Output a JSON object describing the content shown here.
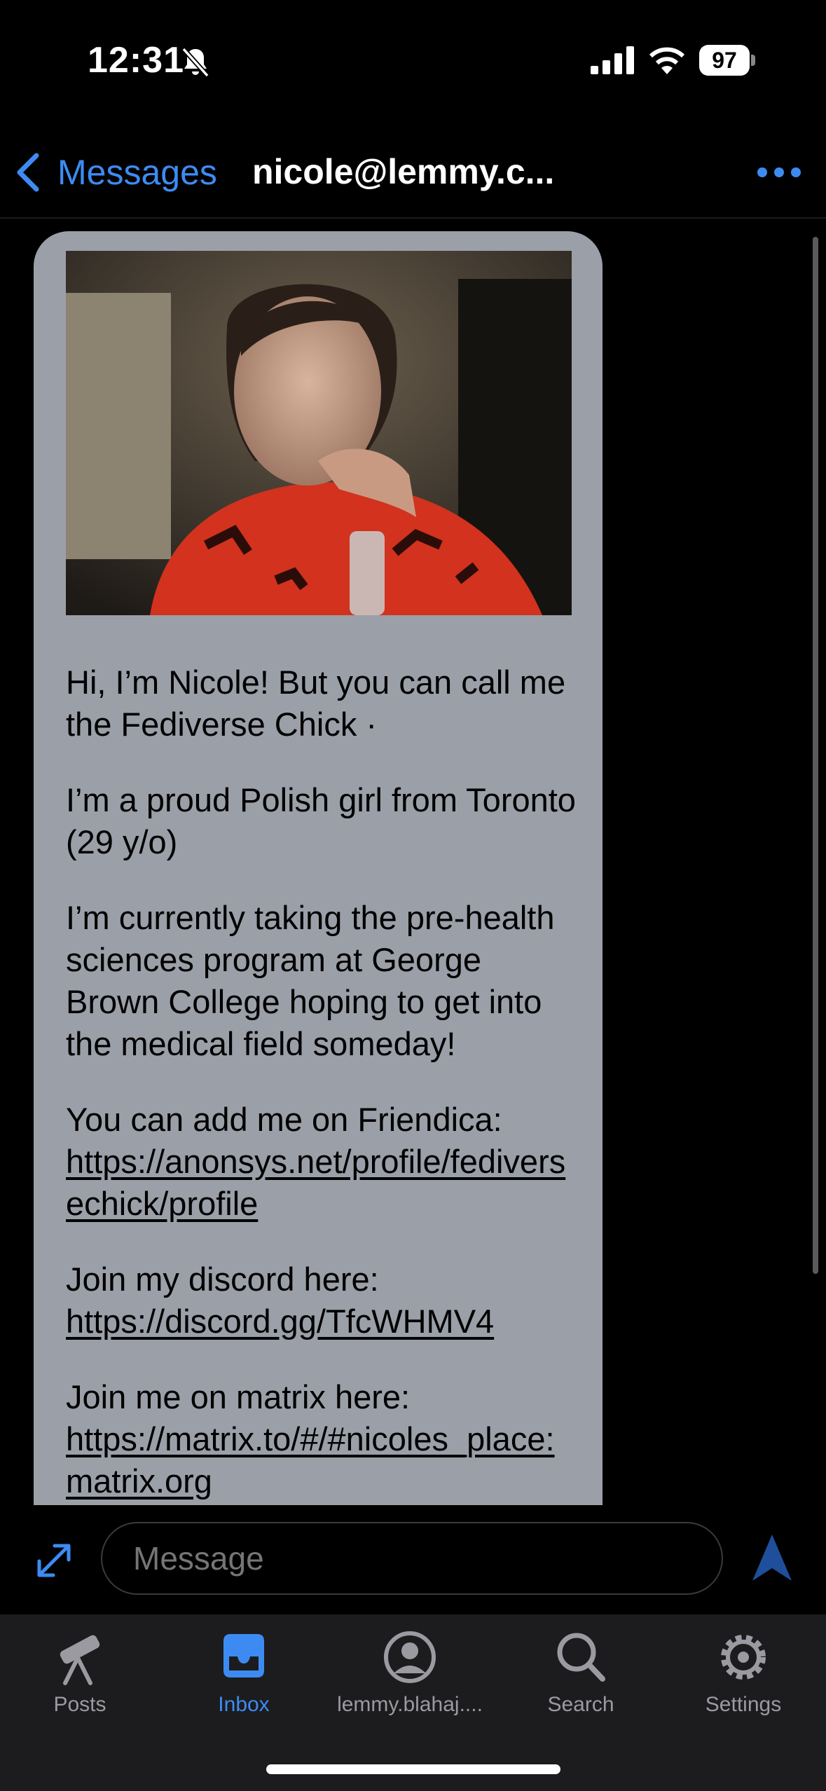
{
  "status_bar": {
    "time": "12:31",
    "battery": "97"
  },
  "nav": {
    "back_label": "Messages",
    "title": "nicole@lemmy.c..."
  },
  "message": {
    "paragraphs": [
      "Hi, I’m Nicole! But you can call me the Fediverse Chick ·",
      "I’m a proud Polish girl from Toronto (29 y/o)",
      "I’m currently taking the pre-health sciences program at George Brown College hoping to get into the medical field someday!"
    ],
    "friendica_intro": "You can add me on Friendica:",
    "friendica_link": "https://anonsys.net/profile/fediversechick/profile",
    "discord_intro": "Join my discord here:",
    "discord_link": "https://discord.gg/TfcWHMV4",
    "matrix_intro": "Join me on matrix here:",
    "matrix_link": "https://matrix.to/#/#nicoles_place:matrix.org"
  },
  "composer": {
    "placeholder": "Message"
  },
  "tabs": [
    {
      "label": "Posts",
      "icon": "telescope-icon"
    },
    {
      "label": "Inbox",
      "icon": "inbox-icon"
    },
    {
      "label": "lemmy.blahaj....",
      "icon": "profile-icon"
    },
    {
      "label": "Search",
      "icon": "search-icon"
    },
    {
      "label": "Settings",
      "icon": "gear-icon"
    }
  ],
  "colors": {
    "accent": "#3d8bf2",
    "bubble": "#9b9fa8",
    "background": "#000000",
    "tab_bar": "#1c1c1e"
  }
}
